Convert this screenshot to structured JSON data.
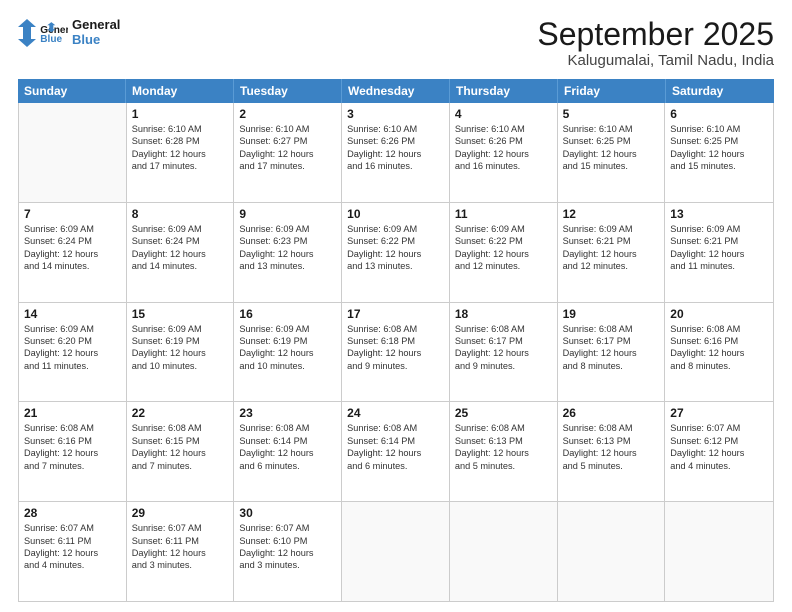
{
  "logo": {
    "line1": "General",
    "line2": "Blue"
  },
  "title": "September 2025",
  "location": "Kalugumalai, Tamil Nadu, India",
  "header_days": [
    "Sunday",
    "Monday",
    "Tuesday",
    "Wednesday",
    "Thursday",
    "Friday",
    "Saturday"
  ],
  "rows": [
    [
      {
        "day": "",
        "lines": []
      },
      {
        "day": "1",
        "lines": [
          "Sunrise: 6:10 AM",
          "Sunset: 6:28 PM",
          "Daylight: 12 hours",
          "and 17 minutes."
        ]
      },
      {
        "day": "2",
        "lines": [
          "Sunrise: 6:10 AM",
          "Sunset: 6:27 PM",
          "Daylight: 12 hours",
          "and 17 minutes."
        ]
      },
      {
        "day": "3",
        "lines": [
          "Sunrise: 6:10 AM",
          "Sunset: 6:26 PM",
          "Daylight: 12 hours",
          "and 16 minutes."
        ]
      },
      {
        "day": "4",
        "lines": [
          "Sunrise: 6:10 AM",
          "Sunset: 6:26 PM",
          "Daylight: 12 hours",
          "and 16 minutes."
        ]
      },
      {
        "day": "5",
        "lines": [
          "Sunrise: 6:10 AM",
          "Sunset: 6:25 PM",
          "Daylight: 12 hours",
          "and 15 minutes."
        ]
      },
      {
        "day": "6",
        "lines": [
          "Sunrise: 6:10 AM",
          "Sunset: 6:25 PM",
          "Daylight: 12 hours",
          "and 15 minutes."
        ]
      }
    ],
    [
      {
        "day": "7",
        "lines": [
          "Sunrise: 6:09 AM",
          "Sunset: 6:24 PM",
          "Daylight: 12 hours",
          "and 14 minutes."
        ]
      },
      {
        "day": "8",
        "lines": [
          "Sunrise: 6:09 AM",
          "Sunset: 6:24 PM",
          "Daylight: 12 hours",
          "and 14 minutes."
        ]
      },
      {
        "day": "9",
        "lines": [
          "Sunrise: 6:09 AM",
          "Sunset: 6:23 PM",
          "Daylight: 12 hours",
          "and 13 minutes."
        ]
      },
      {
        "day": "10",
        "lines": [
          "Sunrise: 6:09 AM",
          "Sunset: 6:22 PM",
          "Daylight: 12 hours",
          "and 13 minutes."
        ]
      },
      {
        "day": "11",
        "lines": [
          "Sunrise: 6:09 AM",
          "Sunset: 6:22 PM",
          "Daylight: 12 hours",
          "and 12 minutes."
        ]
      },
      {
        "day": "12",
        "lines": [
          "Sunrise: 6:09 AM",
          "Sunset: 6:21 PM",
          "Daylight: 12 hours",
          "and 12 minutes."
        ]
      },
      {
        "day": "13",
        "lines": [
          "Sunrise: 6:09 AM",
          "Sunset: 6:21 PM",
          "Daylight: 12 hours",
          "and 11 minutes."
        ]
      }
    ],
    [
      {
        "day": "14",
        "lines": [
          "Sunrise: 6:09 AM",
          "Sunset: 6:20 PM",
          "Daylight: 12 hours",
          "and 11 minutes."
        ]
      },
      {
        "day": "15",
        "lines": [
          "Sunrise: 6:09 AM",
          "Sunset: 6:19 PM",
          "Daylight: 12 hours",
          "and 10 minutes."
        ]
      },
      {
        "day": "16",
        "lines": [
          "Sunrise: 6:09 AM",
          "Sunset: 6:19 PM",
          "Daylight: 12 hours",
          "and 10 minutes."
        ]
      },
      {
        "day": "17",
        "lines": [
          "Sunrise: 6:08 AM",
          "Sunset: 6:18 PM",
          "Daylight: 12 hours",
          "and 9 minutes."
        ]
      },
      {
        "day": "18",
        "lines": [
          "Sunrise: 6:08 AM",
          "Sunset: 6:17 PM",
          "Daylight: 12 hours",
          "and 9 minutes."
        ]
      },
      {
        "day": "19",
        "lines": [
          "Sunrise: 6:08 AM",
          "Sunset: 6:17 PM",
          "Daylight: 12 hours",
          "and 8 minutes."
        ]
      },
      {
        "day": "20",
        "lines": [
          "Sunrise: 6:08 AM",
          "Sunset: 6:16 PM",
          "Daylight: 12 hours",
          "and 8 minutes."
        ]
      }
    ],
    [
      {
        "day": "21",
        "lines": [
          "Sunrise: 6:08 AM",
          "Sunset: 6:16 PM",
          "Daylight: 12 hours",
          "and 7 minutes."
        ]
      },
      {
        "day": "22",
        "lines": [
          "Sunrise: 6:08 AM",
          "Sunset: 6:15 PM",
          "Daylight: 12 hours",
          "and 7 minutes."
        ]
      },
      {
        "day": "23",
        "lines": [
          "Sunrise: 6:08 AM",
          "Sunset: 6:14 PM",
          "Daylight: 12 hours",
          "and 6 minutes."
        ]
      },
      {
        "day": "24",
        "lines": [
          "Sunrise: 6:08 AM",
          "Sunset: 6:14 PM",
          "Daylight: 12 hours",
          "and 6 minutes."
        ]
      },
      {
        "day": "25",
        "lines": [
          "Sunrise: 6:08 AM",
          "Sunset: 6:13 PM",
          "Daylight: 12 hours",
          "and 5 minutes."
        ]
      },
      {
        "day": "26",
        "lines": [
          "Sunrise: 6:08 AM",
          "Sunset: 6:13 PM",
          "Daylight: 12 hours",
          "and 5 minutes."
        ]
      },
      {
        "day": "27",
        "lines": [
          "Sunrise: 6:07 AM",
          "Sunset: 6:12 PM",
          "Daylight: 12 hours",
          "and 4 minutes."
        ]
      }
    ],
    [
      {
        "day": "28",
        "lines": [
          "Sunrise: 6:07 AM",
          "Sunset: 6:11 PM",
          "Daylight: 12 hours",
          "and 4 minutes."
        ]
      },
      {
        "day": "29",
        "lines": [
          "Sunrise: 6:07 AM",
          "Sunset: 6:11 PM",
          "Daylight: 12 hours",
          "and 3 minutes."
        ]
      },
      {
        "day": "30",
        "lines": [
          "Sunrise: 6:07 AM",
          "Sunset: 6:10 PM",
          "Daylight: 12 hours",
          "and 3 minutes."
        ]
      },
      {
        "day": "",
        "lines": []
      },
      {
        "day": "",
        "lines": []
      },
      {
        "day": "",
        "lines": []
      },
      {
        "day": "",
        "lines": []
      }
    ]
  ]
}
